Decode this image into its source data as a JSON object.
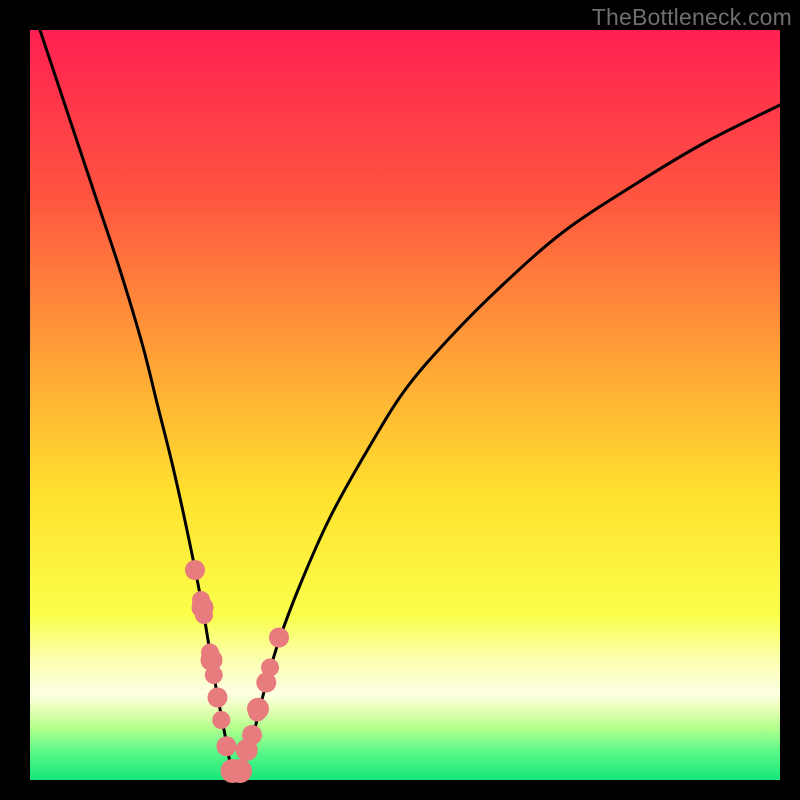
{
  "watermark": "TheBottleneck.com",
  "colors": {
    "black": "#000000",
    "curve": "#000000",
    "dot_fill": "#e77b7d",
    "dot_stroke": "#d86a6c",
    "gradient_stops": [
      {
        "pos": 0.0,
        "color": "#ff2052"
      },
      {
        "pos": 0.22,
        "color": "#ff5440"
      },
      {
        "pos": 0.45,
        "color": "#ffa636"
      },
      {
        "pos": 0.62,
        "color": "#ffe12e"
      },
      {
        "pos": 0.78,
        "color": "#faff4a"
      },
      {
        "pos": 0.84,
        "color": "#fbffb0"
      },
      {
        "pos": 0.885,
        "color": "#fdffe2"
      },
      {
        "pos": 0.905,
        "color": "#e8ffb8"
      },
      {
        "pos": 0.93,
        "color": "#b5ff8e"
      },
      {
        "pos": 0.965,
        "color": "#55f786"
      },
      {
        "pos": 1.0,
        "color": "#17e67a"
      }
    ]
  },
  "chart_data": {
    "type": "line",
    "title": "",
    "xlabel": "",
    "ylabel": "",
    "xlim": [
      0,
      100
    ],
    "ylim": [
      0,
      100
    ],
    "note": "V-shaped bottleneck curve; y≈0 near x≈27; curve rises steeply to both sides. Values estimated from pixels.",
    "series": [
      {
        "name": "bottleneck-curve",
        "x": [
          0,
          3,
          6,
          9,
          12,
          15,
          17,
          19,
          21,
          23,
          24.5,
          26,
          27,
          28,
          29.5,
          31,
          33,
          36,
          40,
          45,
          50,
          56,
          63,
          71,
          80,
          90,
          100
        ],
        "values": [
          104,
          95,
          86,
          77,
          68,
          58,
          50,
          42,
          33,
          23,
          14,
          6,
          1,
          1,
          5,
          11,
          18,
          26,
          35,
          44,
          52,
          59,
          66,
          73,
          79,
          85,
          90
        ]
      }
    ],
    "dots": {
      "name": "sample-points",
      "x": [
        22.0,
        22.8,
        23.0,
        23.2,
        24.0,
        24.2,
        24.5,
        25.0,
        25.5,
        26.2,
        27.0,
        28.0,
        28.8,
        28.9,
        29.6,
        30.3,
        30.4,
        31.5,
        32.0,
        33.2
      ],
      "values": [
        28.0,
        24.0,
        23.0,
        22.0,
        17.0,
        16.0,
        14.0,
        11.0,
        8.0,
        4.5,
        1.2,
        1.2,
        3.8,
        4.0,
        6.0,
        9.0,
        9.5,
        13.0,
        15.0,
        19.0
      ],
      "r": [
        10,
        9,
        11,
        9,
        9,
        11,
        9,
        10,
        9,
        10,
        12,
        12,
        9,
        11,
        10,
        9,
        11,
        10,
        9,
        10
      ]
    }
  }
}
